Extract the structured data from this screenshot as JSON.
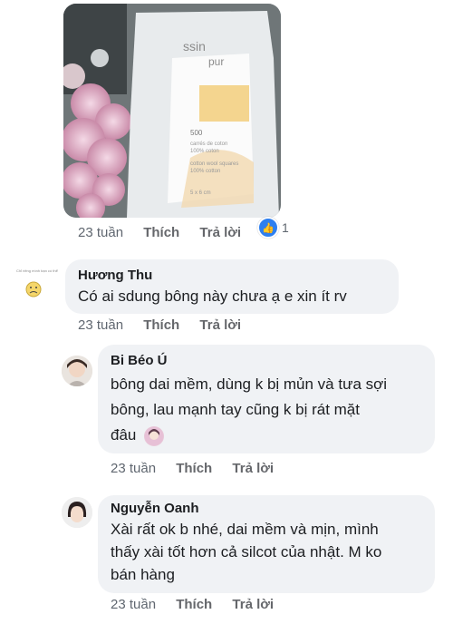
{
  "post": {
    "image_alt_text": "ssin pur 500 carrés de coton 100% coton cotton wool squares 100% cotton 5 x 6 cm",
    "image_text": {
      "brand_line1": "ssin",
      "brand_line2": "pur",
      "count": "500",
      "desc_fr": "carrés de coton",
      "pct_fr": "100% coton",
      "desc_en": "cotton wool squares",
      "pct_en": "100% cotton",
      "size": "5 x 6 cm"
    },
    "meta": {
      "time": "23 tuần",
      "like": "Thích",
      "reply": "Trả lời"
    },
    "reaction_count": "1",
    "reaction_icon": "thumbs-up-icon"
  },
  "comments": [
    {
      "author": "Hương Thu",
      "avatar_label": "Chỉ riêng mình bạn có thể",
      "text": "Có ai sdung bông này chưa ạ e xin ít rv",
      "meta": {
        "time": "23 tuần",
        "like": "Thích",
        "reply": "Trả lời"
      }
    },
    {
      "author": "Bi Béo Ú",
      "text_line1": "bông dai mềm, dùng k bị mủn và tưa sợi",
      "text_line2": "bông, lau mạnh tay cũng k bị rát mặt",
      "text_line3": "đâu",
      "meta": {
        "time": "23 tuần",
        "like": "Thích",
        "reply": "Trả lời"
      }
    },
    {
      "author": "Nguyễn Oanh",
      "text_line1": "Xài rất ok b nhé, dai mềm và mịn, mình",
      "text_line2": "thấy xài tốt hơn cả silcot của nhật. M ko",
      "text_line3": "bán hàng",
      "meta": {
        "time": "23 tuần",
        "like": "Thích",
        "reply": "Trả lời"
      }
    }
  ],
  "colors": {
    "bubble": "#f0f2f5",
    "like_blue": "#2d7ff0",
    "meta_gray": "#606770"
  }
}
